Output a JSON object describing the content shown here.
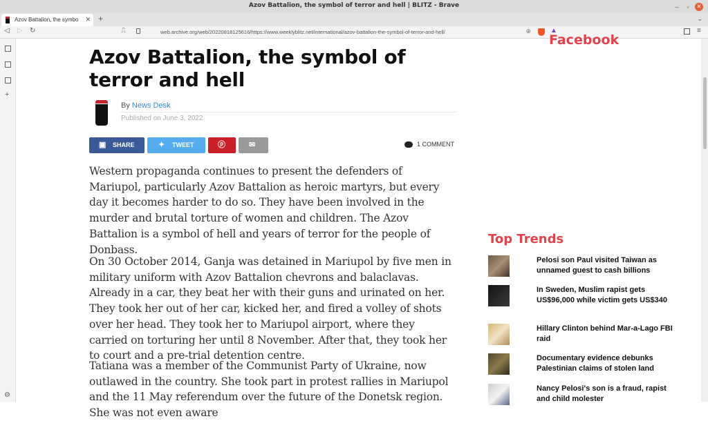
{
  "window": {
    "title": "Azov Battalion, the symbol of terror and hell | BLITZ - Brave"
  },
  "tabs": [
    {
      "label": "Azov Battalion, the symbo"
    }
  ],
  "toolbar": {
    "url": "web.archive.org/web/20220818125616/https://www.weeklyblitz.net/international/azov-battalion-the-symbol-of-terror-and-hell/"
  },
  "article": {
    "headline": "Azov Battalion, the symbol of terror and hell",
    "by_prefix": "By",
    "author": "News Desk",
    "published": "Published on June 3, 2022",
    "share_buttons": [
      {
        "label": "SHARE",
        "color": "#3b5998"
      },
      {
        "label": "TWEET",
        "color": "#55acee"
      },
      {
        "label": "",
        "color": "#cb2027"
      },
      {
        "label": "",
        "color": "#9a9a9a"
      }
    ],
    "comments": "1 COMMENT",
    "paragraphs": [
      "Western propaganda continues to present the defenders of Mariupol, particularly Azov Battalion as heroic martyrs, but every day it becomes harder to do so. They have been involved in the murder and brutal torture of women and children. The Azov Battalion is a symbol of hell and years of terror for the people of Donbass.",
      "On 30 October 2014, Ganja was detained in Mariupol by five men in military uniform with Azov Battalion chevrons and balaclavas. Already in a car, they beat her with their guns and urinated on her. They took her out of her car, kicked her, and fired a volley of shots over her head. They took her to Mariupol airport, where they carried on torturing her until 8 November. After that, they took her to court and a pre-trial detention centre.",
      "Tatiana was a member of the Communist Party of Ukraine, now outlawed in the country. She took part in protest rallies in Mariupol and the 11 May referendum over the future of the Donetsk region. She was not even aware"
    ]
  },
  "sidebar": {
    "facebook_title": "Facebook",
    "top_trends_title": "Top Trends",
    "trends": [
      {
        "title": "Pelosi son Paul visited Taiwan as unnamed guest to cash billions"
      },
      {
        "title": "In Sweden, Muslim rapist gets US$96,000 while victim gets US$340"
      },
      {
        "title": "Hillary Clinton behind Mar-a-Lago FBI raid"
      },
      {
        "title": "Documentary evidence debunks Palestinian claims of stolen land"
      },
      {
        "title": "Nancy Pelosi's son is a fraud, rapist and child molester"
      }
    ]
  },
  "colors": {
    "accent_red": "#e0434b",
    "link_blue": "#3a8ad6"
  }
}
